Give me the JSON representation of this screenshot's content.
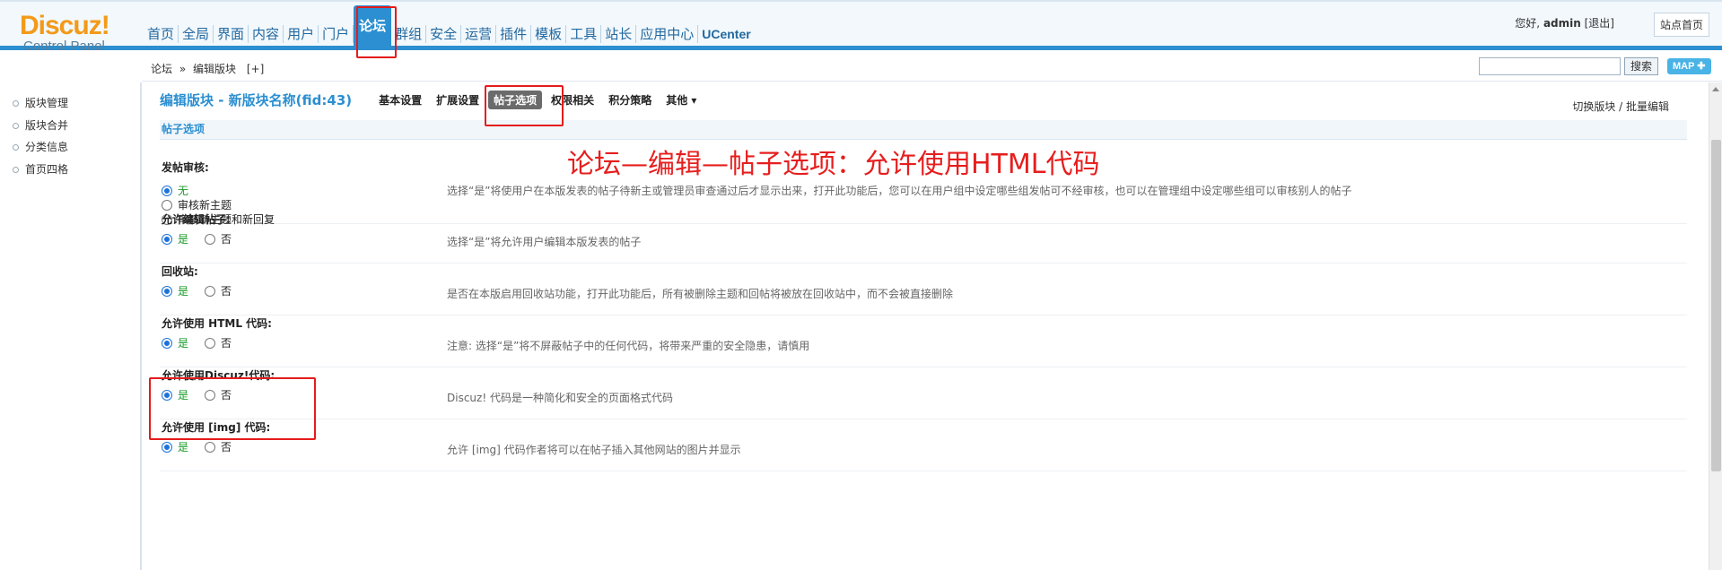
{
  "logo": {
    "main": "Discuz!",
    "sub": "Control Panel"
  },
  "topnav": [
    {
      "label": "首页"
    },
    {
      "label": "全局"
    },
    {
      "label": "界面"
    },
    {
      "label": "内容"
    },
    {
      "label": "用户"
    },
    {
      "label": "门户"
    },
    {
      "label": "论坛",
      "active": true
    },
    {
      "label": "群组"
    },
    {
      "label": "安全"
    },
    {
      "label": "运营"
    },
    {
      "label": "插件"
    },
    {
      "label": "模板"
    },
    {
      "label": "工具"
    },
    {
      "label": "站长"
    },
    {
      "label": "应用中心"
    },
    {
      "label": "UCenter"
    }
  ],
  "user": {
    "greeting": "您好,",
    "name": "admin",
    "logout": "[退出]",
    "site_home": "站点首页"
  },
  "breadcrumb": {
    "root": "论坛",
    "sep": "»",
    "current": "编辑版块",
    "add": "[+]"
  },
  "search": {
    "value": "",
    "button": "搜索",
    "map": "MAP ✚"
  },
  "sidebar": [
    {
      "label": "版块管理"
    },
    {
      "label": "版块合并"
    },
    {
      "label": "分类信息"
    },
    {
      "label": "首页四格"
    }
  ],
  "page": {
    "title": "编辑版块 - 新版块名称(fid:43)",
    "tabs": [
      {
        "label": "基本设置"
      },
      {
        "label": "扩展设置"
      },
      {
        "label": "帖子选项",
        "active": true
      },
      {
        "label": "权限相关"
      },
      {
        "label": "积分策略"
      },
      {
        "label": "其他 ▾"
      }
    ],
    "right_links": "切换版块 / 批量编辑",
    "section": "帖子选项",
    "annotation": "论坛—编辑—帖子选项：允许使用HTML代码"
  },
  "settings": {
    "moderate": {
      "label": "发帖审核:",
      "options": [
        "无",
        "审核新主题",
        "审核新主题和新回复"
      ],
      "desc": "选择“是”将使用户在本版发表的帖子待新主或管理员审查通过后才显示出来，打开此功能后，您可以在用户组中设定哪些组发帖可不经审核，也可以在管理组中设定哪些组可以审核别人的帖子"
    },
    "edit": {
      "label": "允许编辑帖子:",
      "yes": "是",
      "no": "否",
      "desc": "选择“是”将允许用户编辑本版发表的帖子"
    },
    "recycle": {
      "label": "回收站:",
      "yes": "是",
      "no": "否",
      "desc": "是否在本版启用回收站功能，打开此功能后，所有被删除主题和回帖将被放在回收站中，而不会被直接删除"
    },
    "html": {
      "label": "允许使用 HTML 代码:",
      "yes": "是",
      "no": "否",
      "desc": "注意: 选择“是”将不屏蔽帖子中的任何代码，将带来严重的安全隐患，请慎用"
    },
    "discuz": {
      "label": "允许使用Discuz!代码:",
      "yes": "是",
      "no": "否",
      "desc": "Discuz! 代码是一种简化和安全的页面格式代码"
    },
    "img": {
      "label": "允许使用 [img] 代码:",
      "yes": "是",
      "no": "否",
      "desc": "允许 [img] 代码作者将可以在帖子插入其他网站的图片并显示"
    }
  }
}
